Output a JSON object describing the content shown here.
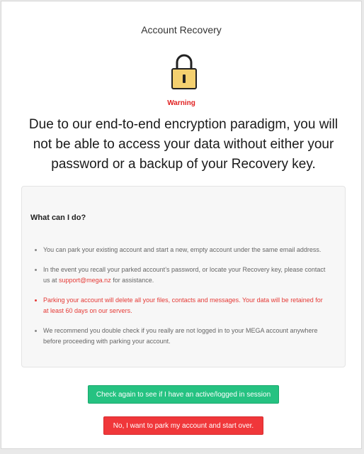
{
  "dialog": {
    "title": "Account Recovery",
    "warning_label": "Warning",
    "headline": "Due to our end-to-end encryption paradigm, you will not be able to access your data without either your password or a backup of your Recovery key."
  },
  "panel": {
    "heading": "What can I do?",
    "items": [
      {
        "text": "You can park your existing account and start a new, empty account under the same email address."
      },
      {
        "text_before": "In the event you recall your parked account’s password, or locate your Recovery key, please contact us at ",
        "link": "support@mega.nz",
        "text_after": " for assistance."
      },
      {
        "text": "Parking your account will delete all your files, contacts and messages. Your data will be retained for at least 60 days on our servers."
      },
      {
        "text": "We recommend you double check if you really are not logged in to your MEGA account anywhere before proceeding with parking your account."
      }
    ]
  },
  "buttons": {
    "check_session": "Check again to see if I have an active/logged in session",
    "park_account": "No, I want to park my account and start over."
  },
  "colors": {
    "warning": "#e02020",
    "danger_text": "#e53935",
    "check_button": "#25c281",
    "park_button": "#f0373a",
    "lock_body": "#f4d06f"
  },
  "icons": {
    "lock": "padlock-icon"
  }
}
